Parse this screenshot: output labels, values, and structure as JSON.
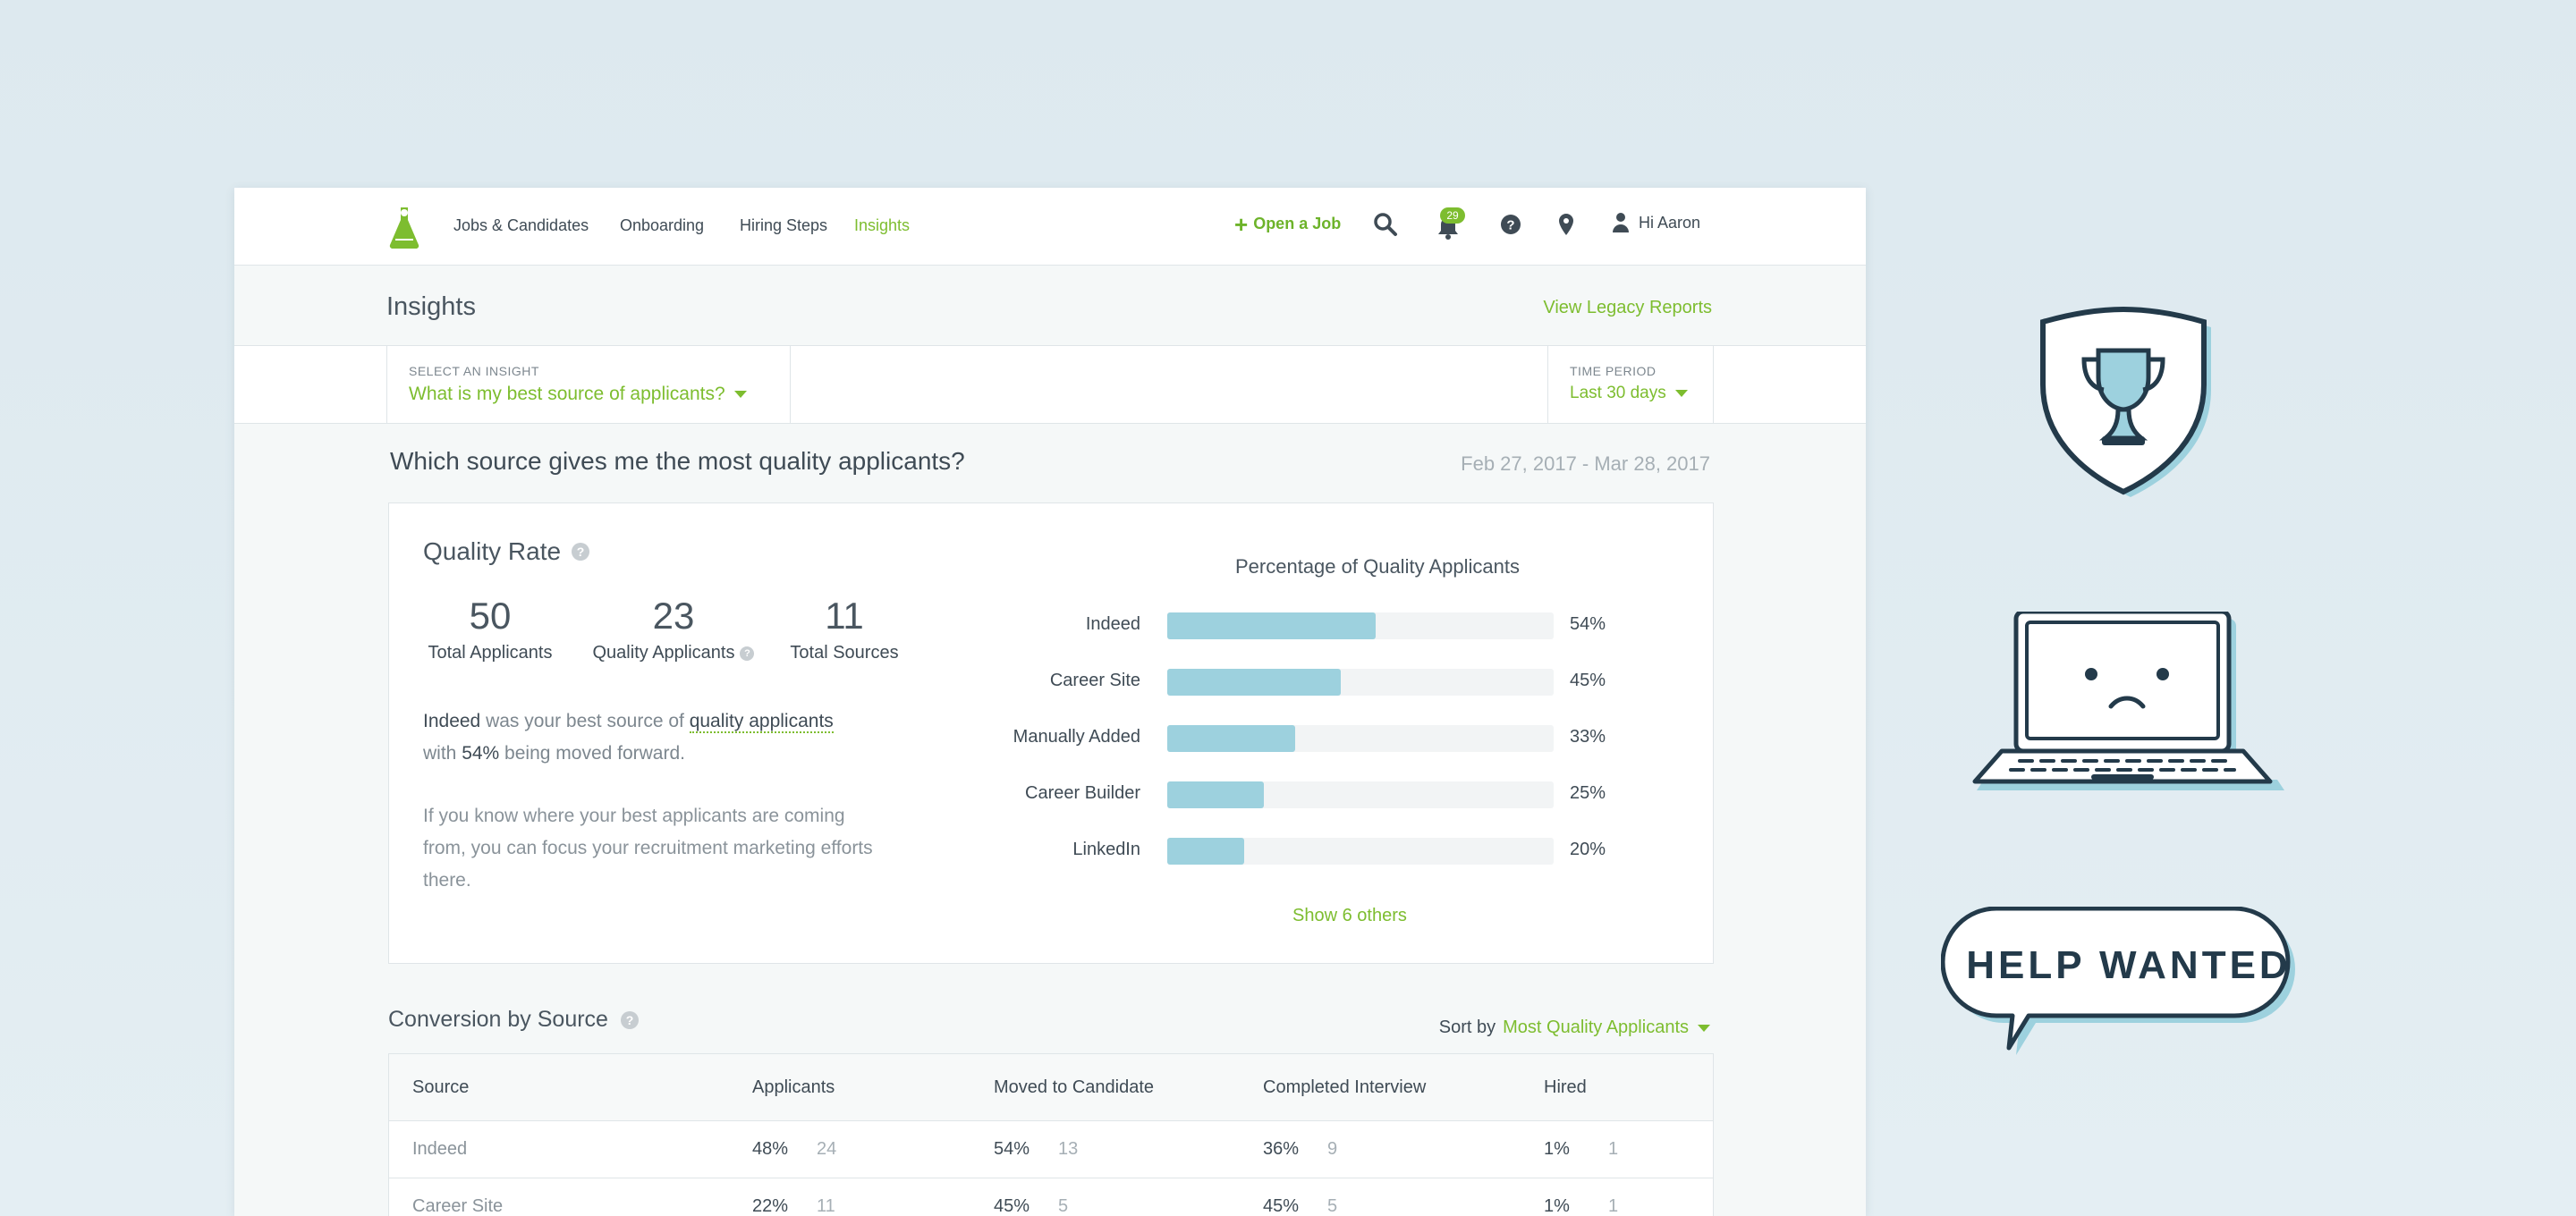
{
  "nav": {
    "links": [
      "Jobs & Candidates",
      "Onboarding",
      "Hiring Steps",
      "Insights"
    ],
    "active": "Insights",
    "open_job": "Open a Job",
    "notifications": "29",
    "user_greeting": "Hi Aaron",
    "icons": [
      "search-icon",
      "bell-icon",
      "help-icon",
      "location-pin-icon",
      "user-icon"
    ]
  },
  "header": {
    "title": "Insights",
    "legacy_link": "View Legacy Reports"
  },
  "selectors": {
    "insight_label": "SELECT AN INSIGHT",
    "insight_value": "What is my best source of applicants?",
    "period_label": "TIME PERIOD",
    "period_value": "Last 30 days"
  },
  "question": {
    "text": "Which source gives me the most quality applicants?",
    "date_range": "Feb 27, 2017 - Mar 28, 2017"
  },
  "quality": {
    "title": "Quality Rate",
    "stats": [
      {
        "value": "50",
        "label": "Total Applicants"
      },
      {
        "value": "23",
        "label": "Quality Applicants"
      },
      {
        "value": "11",
        "label": "Total Sources"
      }
    ],
    "summary": {
      "source": "Indeed",
      "part1": " was your best source of ",
      "link": "quality applicants",
      "part2": "with ",
      "pct": "54%",
      "part3": " being moved forward."
    },
    "advice": "If you know where your best applicants are coming from, you can focus your recruitment marketing efforts there.",
    "show_others": "Show 6 others"
  },
  "chart_data": {
    "type": "bar",
    "title": "Percentage of Quality Applicants",
    "categories": [
      "Indeed",
      "Career Site",
      "Manually Added",
      "Career Builder",
      "LinkedIn"
    ],
    "values": [
      54,
      45,
      33,
      25,
      20
    ],
    "value_labels": [
      "54%",
      "45%",
      "33%",
      "25%",
      "20%"
    ],
    "ylim": [
      0,
      100
    ],
    "orientation": "horizontal",
    "color": "#9dd1de"
  },
  "conversion": {
    "title": "Conversion by Source",
    "sort_label": "Sort by",
    "sort_value": "Most Quality Applicants",
    "columns": [
      "Source",
      "Applicants",
      "Moved to Candidate",
      "Completed Interview",
      "Hired"
    ],
    "rows": [
      {
        "source": "Indeed",
        "cells": [
          [
            "48%",
            "24"
          ],
          [
            "54%",
            "13"
          ],
          [
            "36%",
            "9"
          ],
          [
            "1%",
            "1"
          ]
        ]
      },
      {
        "source": "Career Site",
        "cells": [
          [
            "22%",
            "11"
          ],
          [
            "45%",
            "5"
          ],
          [
            "45%",
            "5"
          ],
          [
            "1%",
            "1"
          ]
        ]
      }
    ]
  },
  "illustrations": {
    "badge": "HELP WANTED",
    "colors": {
      "outline": "#233a4a",
      "fill": "#9dd1de",
      "accent": "#7dbd2f"
    }
  }
}
